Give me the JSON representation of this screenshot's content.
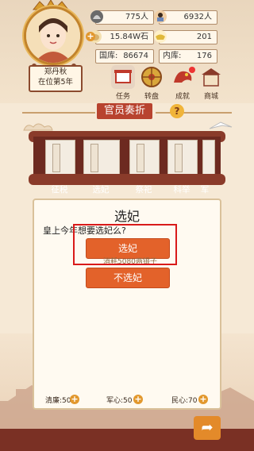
{
  "header": {
    "monarch_name": "郑丹秋",
    "reign": "在位第5年",
    "stats": {
      "soldiers": "775人",
      "people": "6932人",
      "grain": "15.84W石",
      "silver": "201",
      "treasury_label": "国库:",
      "treasury_value": "86674",
      "inner_label": "内库:",
      "inner_value": "176"
    }
  },
  "menu": [
    {
      "label": "任务",
      "icon": "task-scroll-icon"
    },
    {
      "label": "转盘",
      "icon": "wheel-icon"
    },
    {
      "label": "成就",
      "icon": "dragon-icon"
    },
    {
      "label": "商城",
      "icon": "shop-icon"
    }
  ],
  "banner": {
    "title": "官员奏折",
    "help": "?"
  },
  "tabs": [
    "征税",
    "选妃",
    "祭祀",
    "科举",
    "军"
  ],
  "dialog": {
    "title": "选妃",
    "question": "皇上今年想要选妃么?",
    "confirm": "选妃",
    "cost": "消耗5080两银子",
    "cancel": "不选妃"
  },
  "bottom": {
    "qinglian": "清廉:50",
    "junxin": "军心:50",
    "minxin": "民心:70"
  },
  "colors": {
    "accent": "#e3622a",
    "brand": "#b8432f"
  }
}
